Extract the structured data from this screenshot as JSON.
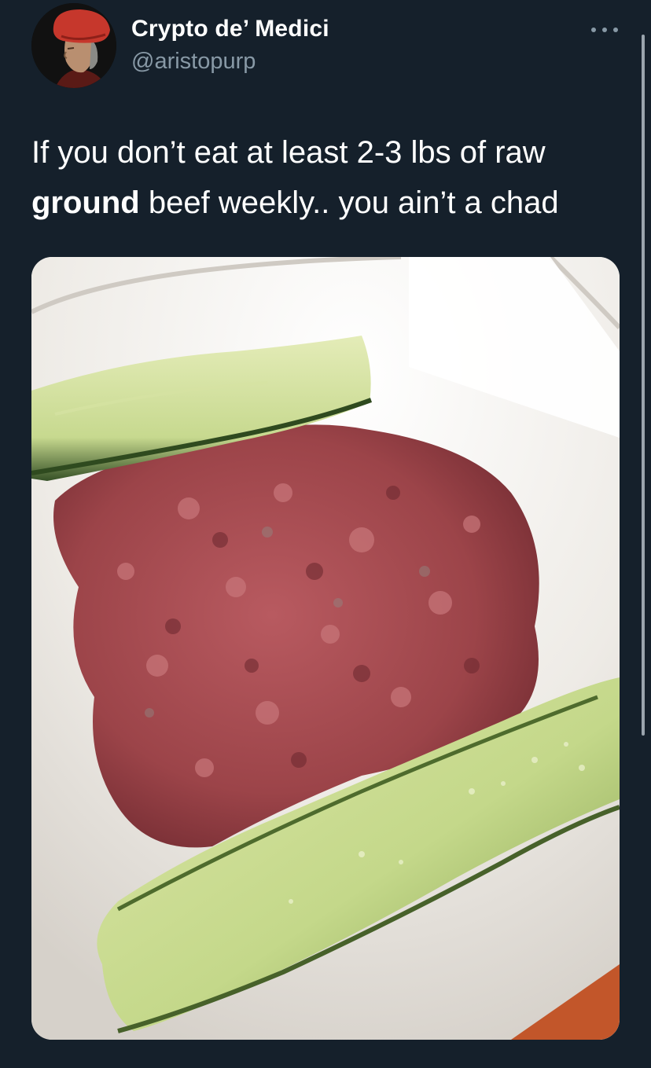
{
  "author": {
    "display_name": "Crypto de’ Medici",
    "handle": "@aristopurp",
    "avatar_icon": "portrait-avatar"
  },
  "tweet": {
    "text_before": "If you don’t eat at least 2-3 lbs of raw ",
    "text_bold": "ground",
    "text_after": " beef weekly.. you ain’t a chad"
  },
  "icons": {
    "more": "more-horizontal-icon"
  },
  "colors": {
    "background": "#15202b",
    "handle_gray": "#8899a6",
    "text_white": "#ffffff"
  }
}
